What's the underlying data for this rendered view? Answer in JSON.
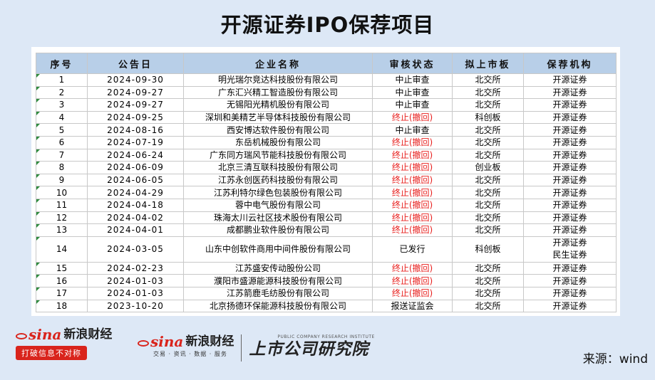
{
  "title": "开源证券IPO保荐项目",
  "table": {
    "headers": [
      "序号",
      "公告日",
      "企业名称",
      "审核状态",
      "拟上市板",
      "保荐机构"
    ],
    "rows": [
      {
        "no": "1",
        "date": "2024-09-30",
        "company": "明光瑞尔竞达科技股份有限公司",
        "status": "中止审查",
        "status_red": false,
        "board": "北交所",
        "sponsor": [
          "开源证券"
        ]
      },
      {
        "no": "2",
        "date": "2024-09-27",
        "company": "广东汇兴精工智造股份有限公司",
        "status": "中止审查",
        "status_red": false,
        "board": "北交所",
        "sponsor": [
          "开源证券"
        ]
      },
      {
        "no": "3",
        "date": "2024-09-27",
        "company": "无锡阳光精机股份有限公司",
        "status": "中止审查",
        "status_red": false,
        "board": "北交所",
        "sponsor": [
          "开源证券"
        ]
      },
      {
        "no": "4",
        "date": "2024-09-25",
        "company": "深圳和美精艺半导体科技股份有限公司",
        "status": "终止(撤回)",
        "status_red": true,
        "board": "科创板",
        "sponsor": [
          "开源证券"
        ]
      },
      {
        "no": "5",
        "date": "2024-08-16",
        "company": "西安博达软件股份有限公司",
        "status": "中止审查",
        "status_red": false,
        "board": "北交所",
        "sponsor": [
          "开源证券"
        ]
      },
      {
        "no": "6",
        "date": "2024-07-19",
        "company": "东岳机械股份有限公司",
        "status": "终止(撤回)",
        "status_red": true,
        "board": "北交所",
        "sponsor": [
          "开源证券"
        ]
      },
      {
        "no": "7",
        "date": "2024-06-24",
        "company": "广东同方瑞风节能科技股份有限公司",
        "status": "终止(撤回)",
        "status_red": true,
        "board": "北交所",
        "sponsor": [
          "开源证券"
        ]
      },
      {
        "no": "8",
        "date": "2024-06-09",
        "company": "北京三清互联科技股份有限公司",
        "status": "终止(撤回)",
        "status_red": true,
        "board": "创业板",
        "sponsor": [
          "开源证券"
        ]
      },
      {
        "no": "9",
        "date": "2024-06-05",
        "company": "江苏永创医药科技股份有限公司",
        "status": "终止(撤回)",
        "status_red": true,
        "board": "北交所",
        "sponsor": [
          "开源证券"
        ]
      },
      {
        "no": "10",
        "date": "2024-04-29",
        "company": "江苏利特尔绿色包装股份有限公司",
        "status": "终止(撤回)",
        "status_red": true,
        "board": "北交所",
        "sponsor": [
          "开源证券"
        ]
      },
      {
        "no": "11",
        "date": "2024-04-18",
        "company": "蓉中电气股份有限公司",
        "status": "终止(撤回)",
        "status_red": true,
        "board": "北交所",
        "sponsor": [
          "开源证券"
        ]
      },
      {
        "no": "12",
        "date": "2024-04-02",
        "company": "珠海太川云社区技术股份有限公司",
        "status": "终止(撤回)",
        "status_red": true,
        "board": "北交所",
        "sponsor": [
          "开源证券"
        ]
      },
      {
        "no": "13",
        "date": "2024-04-01",
        "company": "成都鹏业软件股份有限公司",
        "status": "终止(撤回)",
        "status_red": true,
        "board": "北交所",
        "sponsor": [
          "开源证券"
        ]
      },
      {
        "no": "14",
        "date": "2024-03-05",
        "company": "山东中创软件商用中间件股份有限公司",
        "status": "已发行",
        "status_red": false,
        "board": "科创板",
        "sponsor": [
          "开源证券",
          "民生证券"
        ]
      },
      {
        "no": "15",
        "date": "2024-02-23",
        "company": "江苏盛安传动股份公司",
        "status": "终止(撤回)",
        "status_red": true,
        "board": "北交所",
        "sponsor": [
          "开源证券"
        ]
      },
      {
        "no": "16",
        "date": "2024-01-03",
        "company": "濮阳市盛源能源科技股份有限公司",
        "status": "终止(撤回)",
        "status_red": true,
        "board": "北交所",
        "sponsor": [
          "开源证券"
        ]
      },
      {
        "no": "17",
        "date": "2024-01-03",
        "company": "江苏箭鹿毛纺股份有限公司",
        "status": "终止(撤回)",
        "status_red": true,
        "board": "北交所",
        "sponsor": [
          "开源证券"
        ]
      },
      {
        "no": "18",
        "date": "2023-10-20",
        "company": "北京扬德环保能源科技股份有限公司",
        "status": "报送证监会",
        "status_red": false,
        "board": "北交所",
        "sponsor": [
          "开源证券"
        ]
      }
    ]
  },
  "footer": {
    "logo1_latin": "sina",
    "logo1_cn": "新浪财经",
    "logo1_slogan": "打破信息不对称",
    "logo2_latin": "sina",
    "logo2_cn": "新浪财经",
    "logo2_sub": "交易 · 资讯 · 数据 · 服务",
    "logo3_en": "PUBLIC COMPANY RESEARCH INSTITUTE",
    "logo3_cn": "上市公司研究院",
    "source": "来源：wind"
  },
  "colors": {
    "header_bg": "#b8cfe8",
    "page_bg": "#dde8f6",
    "terminated": "#e8201e",
    "brand_red": "#d9241c"
  }
}
